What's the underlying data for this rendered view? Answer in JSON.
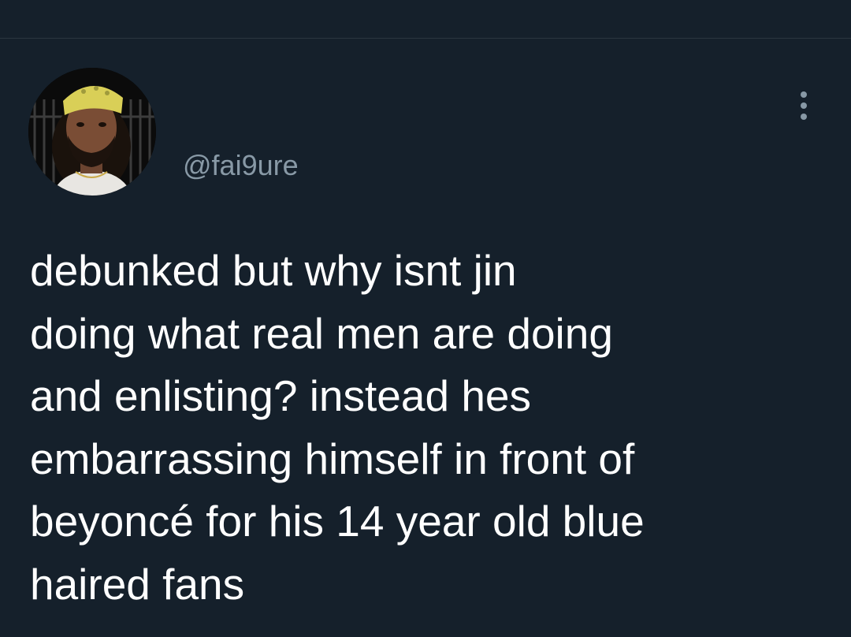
{
  "tweet": {
    "username": "@fai9ure",
    "text_lines": [
      "debunked but why isnt jin",
      "doing what real men are doing",
      "and enlisting? instead hes",
      "embarrassing himself in front of",
      "beyoncé for his 14 year old blue",
      "haired fans"
    ]
  },
  "icons": {
    "more": "more-vertical-icon",
    "avatar": "user-avatar"
  },
  "colors": {
    "background": "#15202b",
    "text_primary": "#ffffff",
    "text_secondary": "#8899a6"
  }
}
